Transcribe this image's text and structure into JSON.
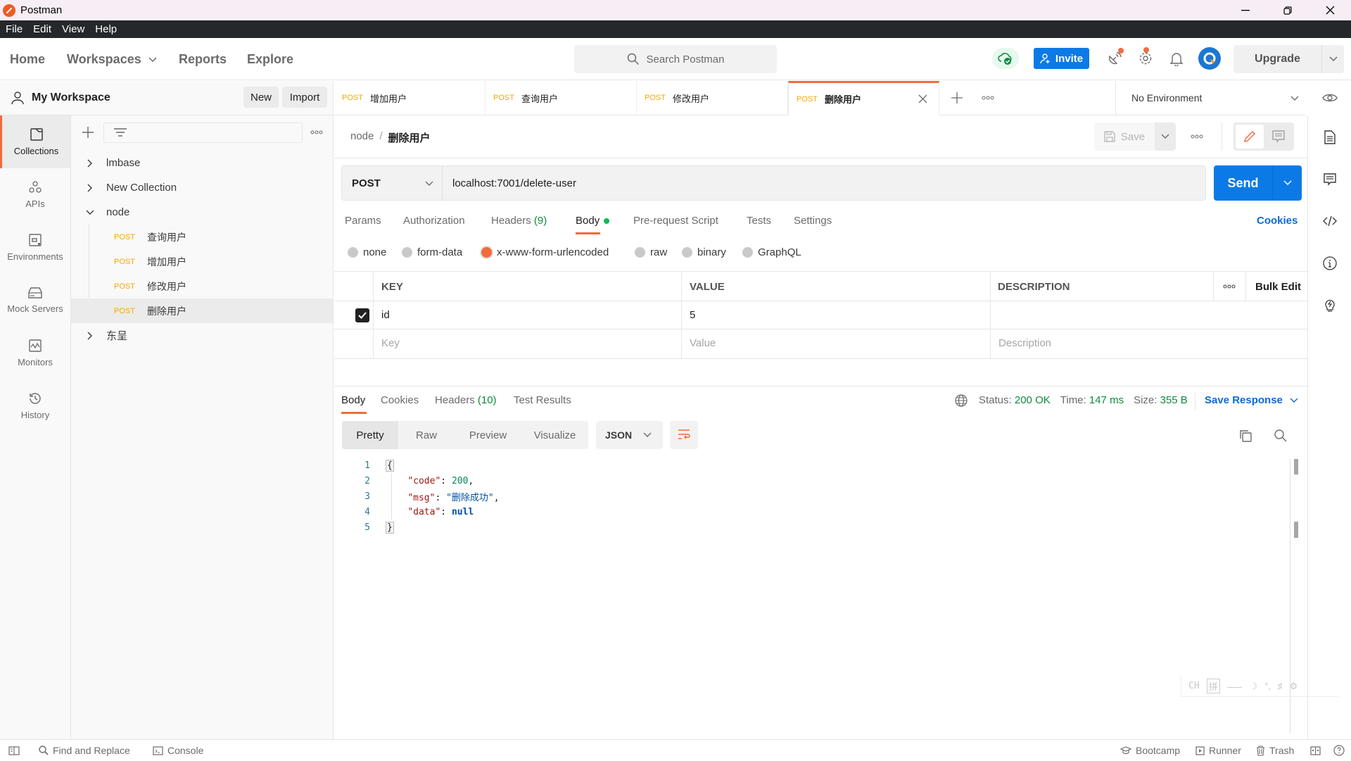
{
  "window": {
    "title": "Postman",
    "logo_color": "#ef5b25"
  },
  "menubar": [
    "File",
    "Edit",
    "View",
    "Help"
  ],
  "header": {
    "nav": [
      "Home",
      "Workspaces",
      "Reports",
      "Explore"
    ],
    "search_placeholder": "Search Postman",
    "invite_label": "Invite",
    "upgrade_label": "Upgrade"
  },
  "workspace": {
    "name": "My Workspace",
    "new_label": "New",
    "import_label": "Import"
  },
  "rail": [
    {
      "label": "Collections",
      "icon": "collections-icon",
      "active": true
    },
    {
      "label": "APIs",
      "icon": "apis-icon"
    },
    {
      "label": "Environments",
      "icon": "environments-icon"
    },
    {
      "label": "Mock Servers",
      "icon": "mock-servers-icon"
    },
    {
      "label": "Monitors",
      "icon": "monitors-icon"
    },
    {
      "label": "History",
      "icon": "history-icon"
    }
  ],
  "collections": [
    {
      "name": "lmbase",
      "expanded": false
    },
    {
      "name": "New Collection",
      "expanded": false
    },
    {
      "name": "node",
      "expanded": true,
      "requests": [
        {
          "method": "POST",
          "name": "查询用户"
        },
        {
          "method": "POST",
          "name": "增加用户"
        },
        {
          "method": "POST",
          "name": "修改用户"
        },
        {
          "method": "POST",
          "name": "删除用户",
          "selected": true
        }
      ]
    },
    {
      "name": "东呈",
      "expanded": false
    }
  ],
  "tabs": [
    {
      "method": "POST",
      "name": "增加用户"
    },
    {
      "method": "POST",
      "name": "查询用户"
    },
    {
      "method": "POST",
      "name": "修改用户"
    },
    {
      "method": "POST",
      "name": "删除用户",
      "active": true
    }
  ],
  "environment": {
    "selected": "No Environment"
  },
  "request": {
    "breadcrumb": {
      "parent": "node",
      "separator": "/",
      "current": "删除用户"
    },
    "save_label": "Save",
    "method": "POST",
    "url": "localhost:7001/delete-user",
    "send_label": "Send",
    "tabs": [
      {
        "label": "Params"
      },
      {
        "label": "Authorization"
      },
      {
        "label": "Headers",
        "count": "(9)"
      },
      {
        "label": "Body",
        "active": true,
        "dot": true
      },
      {
        "label": "Pre-request Script"
      },
      {
        "label": "Tests"
      },
      {
        "label": "Settings"
      }
    ],
    "cookies_label": "Cookies",
    "body_types": [
      {
        "label": "none"
      },
      {
        "label": "form-data"
      },
      {
        "label": "x-www-form-urlencoded",
        "selected": true
      },
      {
        "label": "raw"
      },
      {
        "label": "binary"
      },
      {
        "label": "GraphQL"
      }
    ],
    "table": {
      "headers": [
        "KEY",
        "VALUE",
        "DESCRIPTION"
      ],
      "bulk_edit_label": "Bulk Edit",
      "rows": [
        {
          "checked": true,
          "key": "id",
          "value": "5",
          "description": ""
        }
      ],
      "placeholder": {
        "key": "Key",
        "value": "Value",
        "description": "Description"
      }
    }
  },
  "response": {
    "tabs": [
      {
        "label": "Body",
        "active": true
      },
      {
        "label": "Cookies"
      },
      {
        "label": "Headers",
        "count": "(10)"
      },
      {
        "label": "Test Results"
      }
    ],
    "status_label": "Status:",
    "status": "200 OK",
    "time_label": "Time:",
    "time": "147 ms",
    "size_label": "Size:",
    "size": "355 B",
    "save_response_label": "Save Response",
    "views": [
      "Pretty",
      "Raw",
      "Preview",
      "Visualize"
    ],
    "active_view": "Pretty",
    "format": "JSON",
    "body_lines": [
      {
        "n": "1",
        "text": "{"
      },
      {
        "n": "2",
        "key": "\"code\"",
        "value": "200",
        "type": "number",
        "trail": ","
      },
      {
        "n": "3",
        "key": "\"msg\"",
        "value": "\"删除成功\"",
        "type": "string",
        "trail": ","
      },
      {
        "n": "4",
        "key": "\"data\"",
        "value": "null",
        "type": "null",
        "trail": ""
      },
      {
        "n": "5",
        "text": "}"
      }
    ]
  },
  "statusbar": {
    "find_replace": "Find and Replace",
    "console": "Console",
    "bootcamp": "Bootcamp",
    "runner": "Runner",
    "trash": "Trash"
  },
  "ime": {
    "label": "CH",
    "mode": "拼"
  },
  "colors": {
    "accent": "#f26b3a",
    "primary": "#0c7ae6",
    "method_post": "#f4a900",
    "success": "#0f8a3e"
  }
}
